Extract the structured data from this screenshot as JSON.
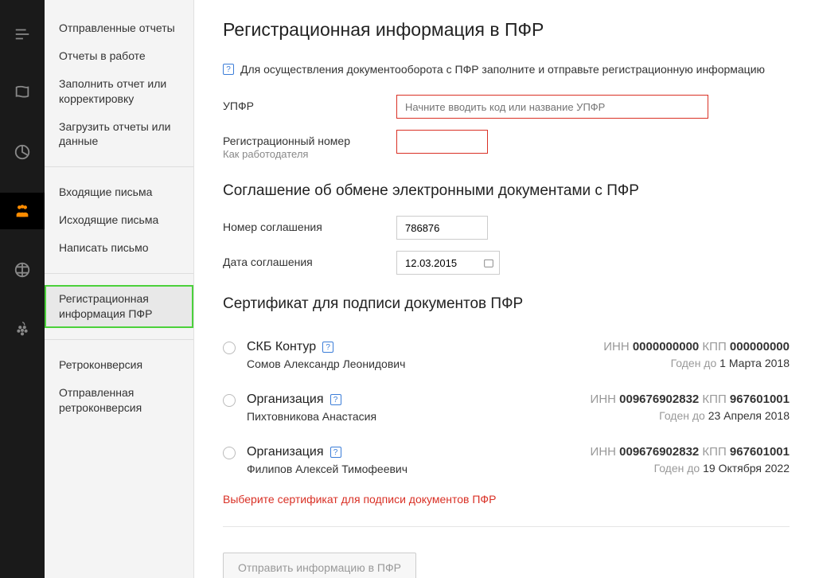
{
  "sidebar": {
    "group1": [
      "Отправленные отчеты",
      "Отчеты в работе",
      "Заполнить отчет или корректировку",
      "Загрузить отчеты или данные"
    ],
    "group2": [
      "Входящие письма",
      "Исходящие письма",
      "Написать письмо"
    ],
    "group3": [
      "Регистрационная информация ПФР"
    ],
    "group4": [
      "Ретроконверсия",
      "Отправленная ретроконверсия"
    ]
  },
  "page": {
    "title": "Регистрационная информация в ПФР",
    "info": "Для осуществления документооборота с ПФР заполните и отправьте регистрационную информацию",
    "labels": {
      "upfr": "УПФР",
      "upfr_ph": "Начните вводить код или название УПФР",
      "reg_num": "Регистрационный номер",
      "reg_num_sub": "Как работодателя"
    }
  },
  "agreement": {
    "heading": "Соглашение об обмене электронными документами с ПФР",
    "num_label": "Номер соглашения",
    "num_value": "786876",
    "date_label": "Дата соглашения",
    "date_value": "12.03.2015"
  },
  "cert": {
    "heading": "Сертификат для подписи документов ПФР",
    "inn_label": "ИНН",
    "kpp_label": "КПП",
    "valid_prefix": "Годен до",
    "items": [
      {
        "org": "СКБ Контур",
        "person": "Сомов Александр Леонидович",
        "inn": "0000000000",
        "kpp": "000000000",
        "valid": "1 Марта 2018"
      },
      {
        "org": "Организация",
        "person": "Пихтовникова Анастасия",
        "inn": "009676902832",
        "kpp": "967601001",
        "valid": "23 Апреля 2018"
      },
      {
        "org": "Организация",
        "person": "Филипов Алексей Тимофеевич",
        "inn": "009676902832",
        "kpp": "967601001",
        "valid": "19 Октября 2022"
      }
    ],
    "error": "Выберите сертификат для подписи документов ПФР"
  },
  "submit": "Отправить информацию в ПФР"
}
